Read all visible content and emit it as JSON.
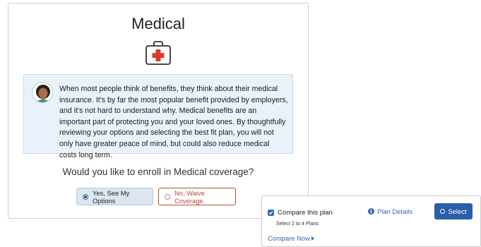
{
  "medical": {
    "title": "Medical",
    "icon": "medical-kit-icon",
    "description": "When most people think of benefits, they think about their medical insurance. It's by far the most popular benefit provided by employers, and it's not hard to understand why. Medical benefits are an important part of protecting you and your loved ones. By thoughtfully reviewing your options and selecting the best fit plan, you will not only have greater peace of mind, but could also reduce medical costs long term.",
    "question": "Would you like to enroll in Medical coverage?",
    "options": [
      {
        "label": "Yes, See My Options",
        "selected": true
      },
      {
        "label": "No, Waive Coverage",
        "selected": false
      }
    ]
  },
  "compare": {
    "checkbox_label": "Compare this plan",
    "checked": true,
    "sublabel": "Select 2 to 4 Plans",
    "plan_details_label": "Plan Details",
    "select_label": "Select",
    "compare_now_label": "Compare Now"
  },
  "colors": {
    "accent": "#2a5ea9",
    "waive": "#b84a3a",
    "info_bg": "#e9f2fa"
  }
}
